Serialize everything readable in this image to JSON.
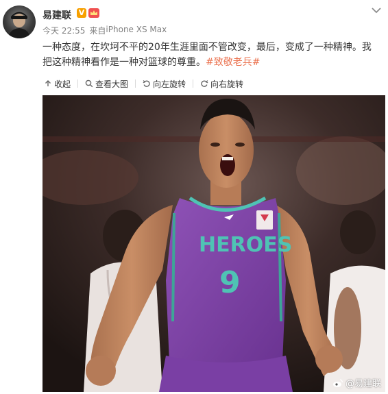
{
  "post": {
    "username": "易建联",
    "verified_badge": "V",
    "timestamp": "今天 22:55",
    "source_prefix": "来自",
    "device": "iPhone XS Max",
    "text": "一种态度，在坎坷不平的20年生涯里面不管改变，最后，变成了一种精神。我把这种精神看作是一种对篮球的尊重。",
    "hashtag": "#致敬老兵#"
  },
  "toolbar": {
    "collapse_label": "收起",
    "view_large_label": "查看大图",
    "rotate_left_label": "向左旋转",
    "rotate_right_label": "向右旋转"
  },
  "photo": {
    "jersey_text": "HEROES",
    "jersey_number": "9",
    "watermark": "@易建联"
  },
  "icons": {
    "collapse": "arrow-up-icon",
    "view_large": "magnifier-icon",
    "rotate_left": "rotate-left-icon",
    "rotate_right": "rotate-right-icon",
    "menu": "chevron-down-icon"
  },
  "colors": {
    "topic": "#eb7350",
    "verified": "#f7a000",
    "jersey": "#7b3fa0",
    "jersey_text": "#4fc3b4"
  }
}
